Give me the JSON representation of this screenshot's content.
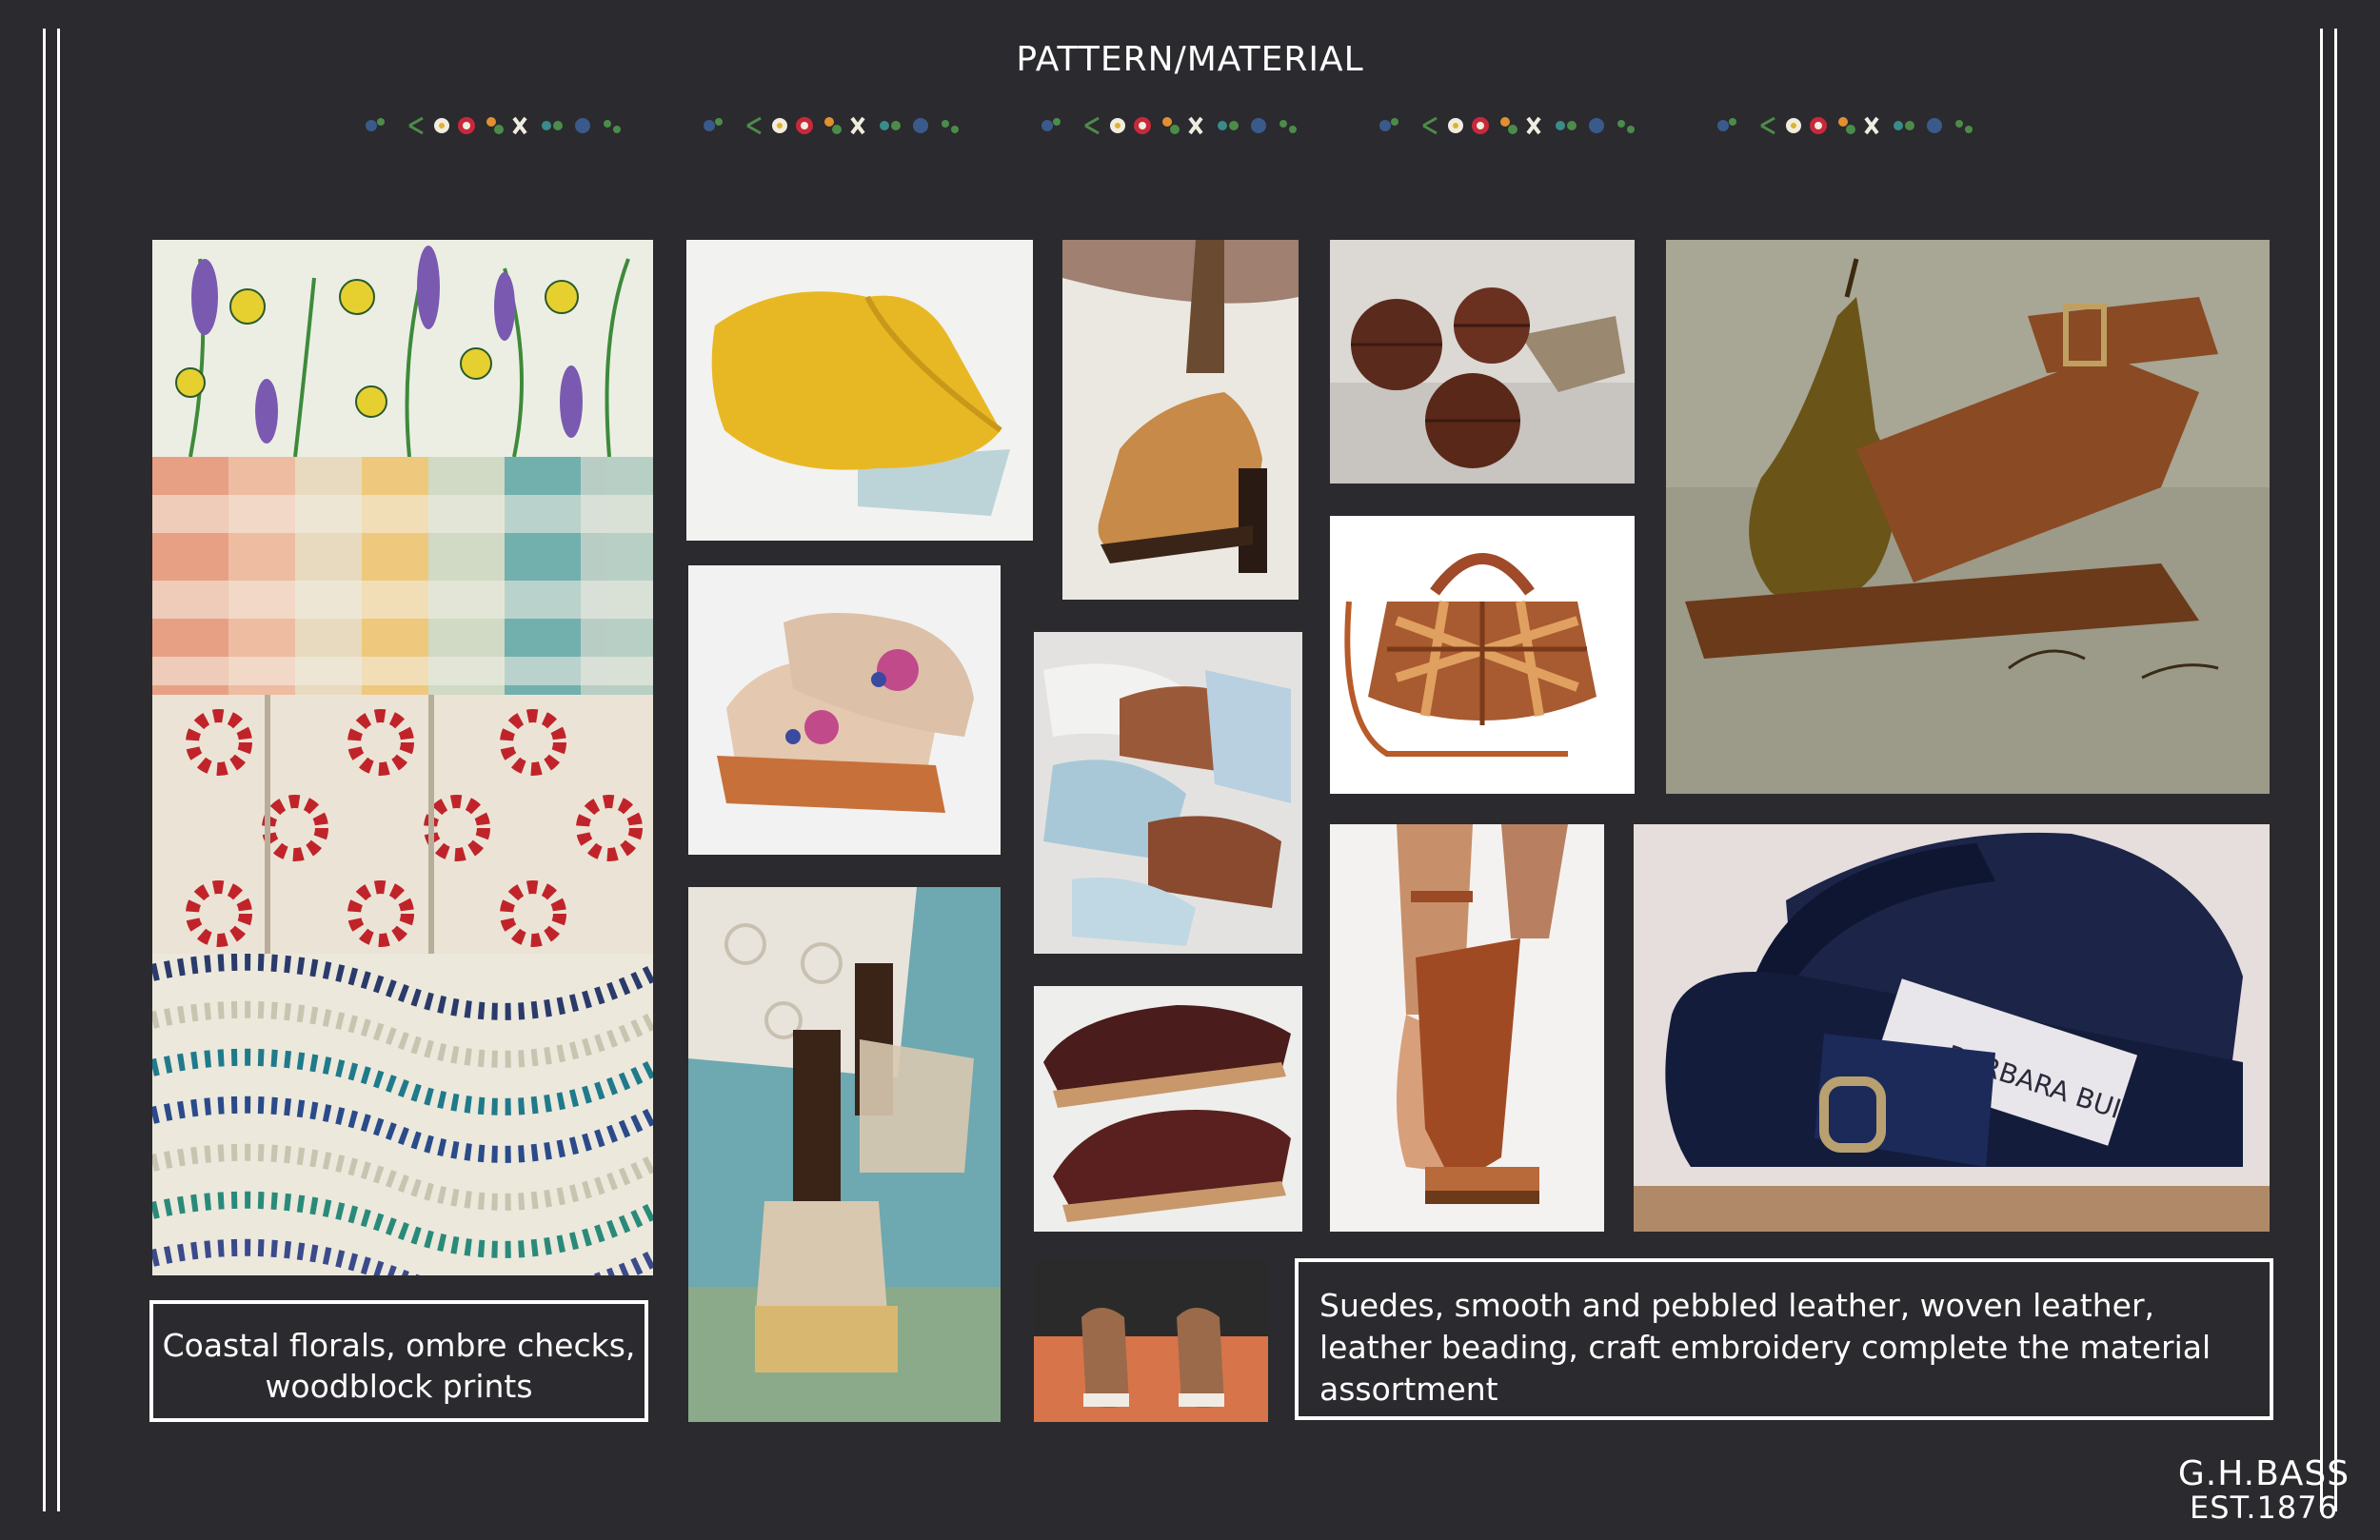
{
  "page": {
    "title": "PATTERN/MATERIAL",
    "background": "#2b2a2e"
  },
  "captions": {
    "left": "Coastal florals, ombre checks, woodblock prints",
    "right": "Suedes, smooth and pebbled leather, woven leather, leather beading, craft embroidery complete the material assortment"
  },
  "brand": {
    "name": "G.H.BASS",
    "established": "EST.1876"
  },
  "images": [
    {
      "name": "coastal-floral-print",
      "subject": "wildflower botanical print"
    },
    {
      "name": "ombre-check-fabric",
      "subject": "woven ombre check textile"
    },
    {
      "name": "woodblock-print-fabric",
      "subject": "red woodblock floral print"
    },
    {
      "name": "wave-pattern-fabric",
      "subject": "blue wave dash print"
    },
    {
      "name": "yellow-leather-swatch",
      "subject": "yellow smooth leather"
    },
    {
      "name": "embroidered-loafer-image",
      "subject": "embroidered suede loafers on lug sole"
    },
    {
      "name": "crochet-runway-sandal-image",
      "subject": "woven cage sandal on espadrille platform"
    },
    {
      "name": "tan-heeled-loafer-image",
      "subject": "tan leather heeled loafer"
    },
    {
      "name": "leather-mules-pile-image",
      "subject": "blue and brown leather mules"
    },
    {
      "name": "burgundy-loafers-image",
      "subject": "burgundy leather loafers"
    },
    {
      "name": "suede-slip-ons-image",
      "subject": "suede slip-ons on orange backdrop"
    },
    {
      "name": "leather-balls-image",
      "subject": "brown leather spheres"
    },
    {
      "name": "woven-leather-bag-image",
      "subject": "woven leather handbag"
    },
    {
      "name": "brown-platform-sandal-image",
      "subject": "brown leather platform sandal on foot"
    },
    {
      "name": "suede-sandal-pear-image",
      "subject": "brown suede buckle sandal with pear"
    },
    {
      "name": "navy-suede-slide-image",
      "subject": "navy suede buckle slide",
      "label": "BARBARA BUI"
    }
  ],
  "colors": {
    "frame": "#ffffff",
    "text": "#ffffff"
  }
}
